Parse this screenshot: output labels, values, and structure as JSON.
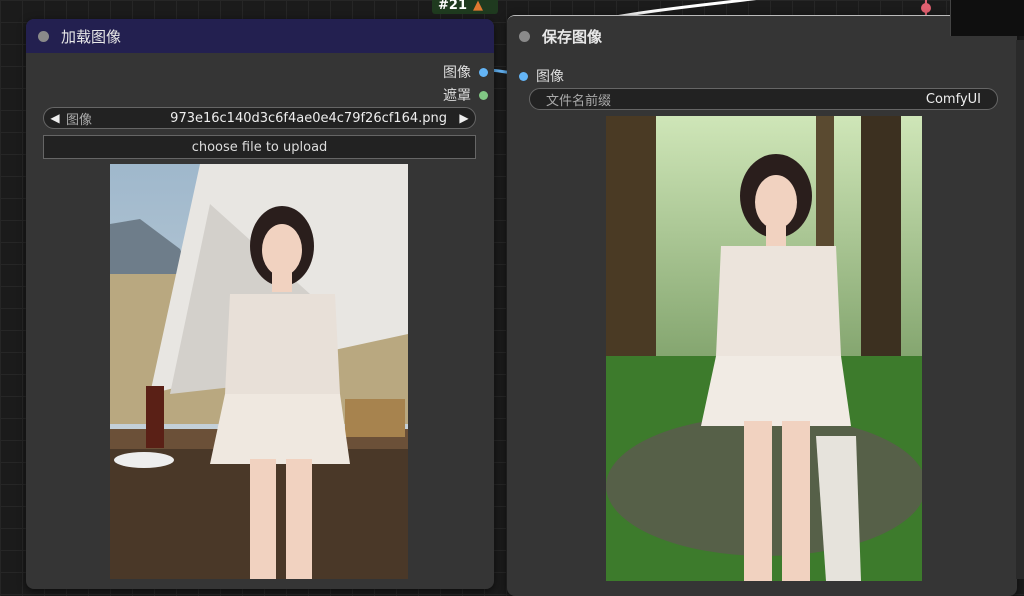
{
  "load_node": {
    "id_badge": "#21",
    "title": "加载图像",
    "outputs": [
      {
        "label": "图像",
        "color": "#64b5f6"
      },
      {
        "label": "遮罩",
        "color": "#81c784"
      }
    ],
    "image_widget": {
      "label": "图像",
      "value": "973e16c140d3c6f4ae0e4c79f26cf164.png"
    },
    "upload_button": "choose file to upload",
    "header_color": "#232050"
  },
  "save_node": {
    "title": "保存图像",
    "input": {
      "label": "图像",
      "color": "#64b5f6"
    },
    "filename_prefix": {
      "label": "文件名前缀",
      "value": "ComfyUI"
    }
  }
}
